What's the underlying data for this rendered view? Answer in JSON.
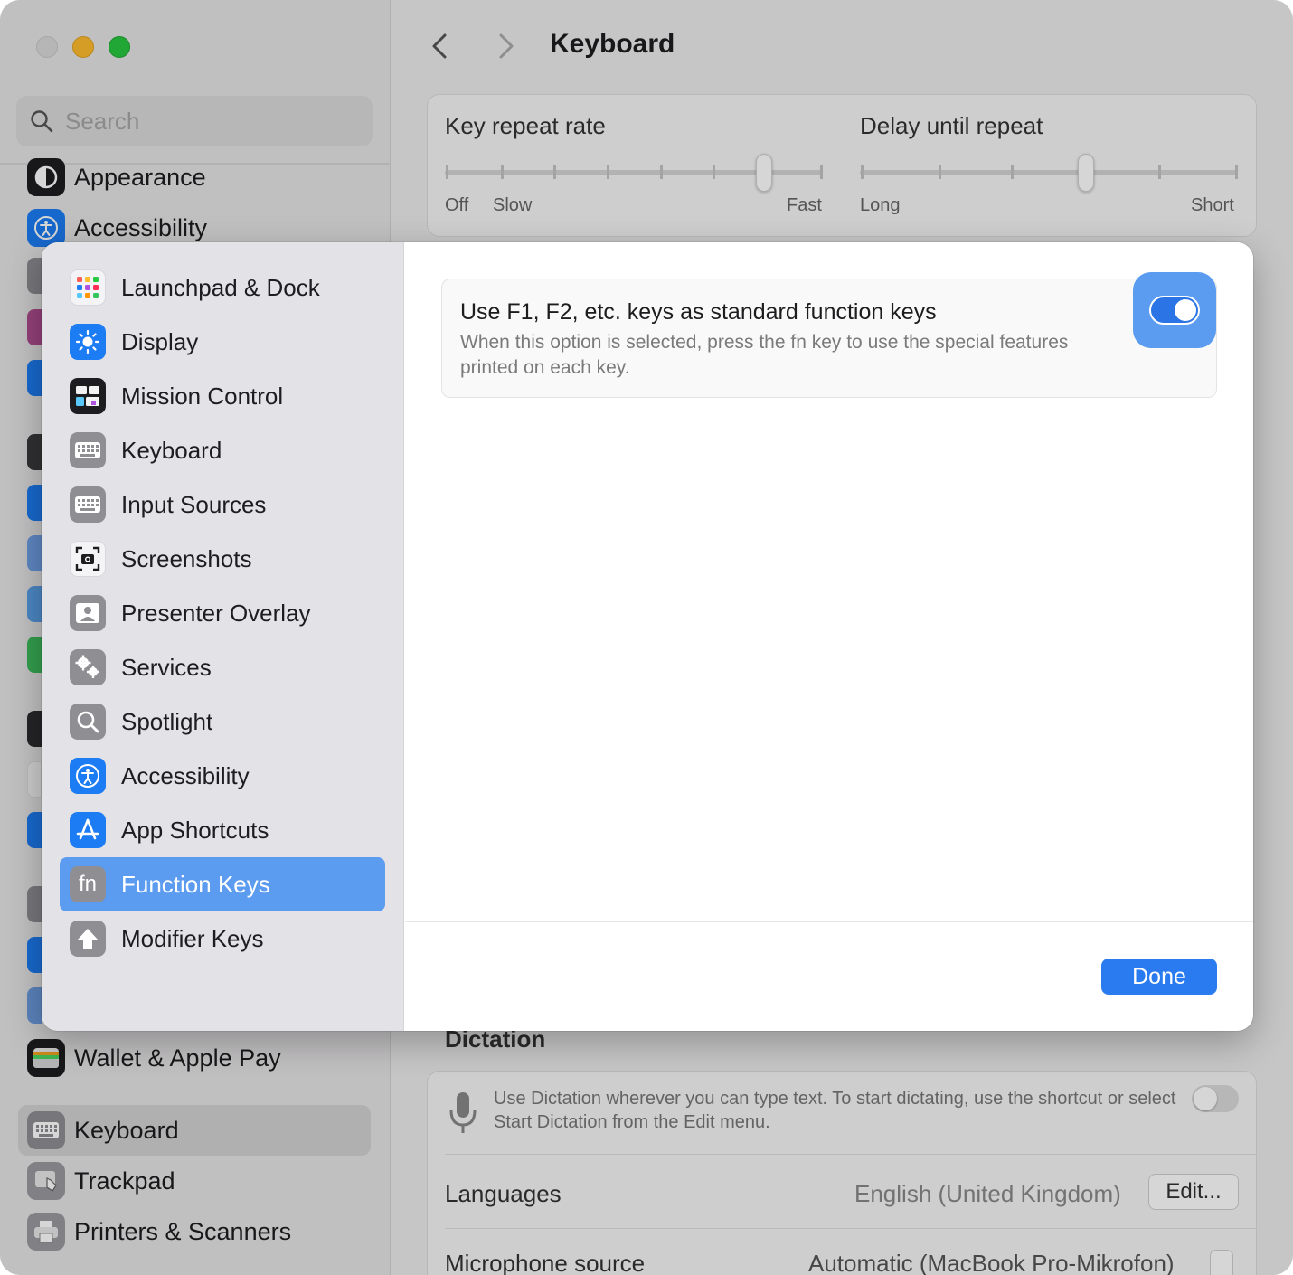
{
  "sidebar": {
    "search_placeholder": "Search",
    "items": [
      {
        "label": "Appearance"
      },
      {
        "label": "Accessibility"
      },
      {
        "label": "Wallet & Apple Pay"
      },
      {
        "label": "Keyboard"
      },
      {
        "label": "Trackpad"
      },
      {
        "label": "Printers & Scanners"
      }
    ]
  },
  "main": {
    "title": "Keyboard",
    "key_repeat": {
      "label": "Key repeat rate",
      "off": "Off",
      "slow": "Slow",
      "fast": "Fast",
      "value_step": 7,
      "steps": 8
    },
    "delay_repeat": {
      "label": "Delay until repeat",
      "long": "Long",
      "short": "Short",
      "value_step": 4,
      "steps": 6
    },
    "dictation": {
      "title": "Dictation",
      "description": "Use Dictation wherever you can type text. To start dictating, use the shortcut or select Start Dictation from the Edit menu.",
      "enabled": false,
      "languages_label": "Languages",
      "languages_value": "English (United Kingdom)",
      "edit_button": "Edit...",
      "mic_label": "Microphone source",
      "mic_value": "Automatic (MacBook Pro-Mikrofon)"
    }
  },
  "sheet": {
    "items": [
      {
        "label": "Launchpad & Dock",
        "icon": "launchpad-icon"
      },
      {
        "label": "Display",
        "icon": "display-icon"
      },
      {
        "label": "Mission Control",
        "icon": "mission-control-icon"
      },
      {
        "label": "Keyboard",
        "icon": "keyboard-icon"
      },
      {
        "label": "Input Sources",
        "icon": "input-sources-icon"
      },
      {
        "label": "Screenshots",
        "icon": "screenshots-icon"
      },
      {
        "label": "Presenter Overlay",
        "icon": "presenter-overlay-icon"
      },
      {
        "label": "Services",
        "icon": "services-icon"
      },
      {
        "label": "Spotlight",
        "icon": "spotlight-icon"
      },
      {
        "label": "Accessibility",
        "icon": "accessibility-icon"
      },
      {
        "label": "App Shortcuts",
        "icon": "app-shortcuts-icon"
      },
      {
        "label": "Function Keys",
        "icon": "fn-icon"
      },
      {
        "label": "Modifier Keys",
        "icon": "modifier-keys-icon"
      }
    ],
    "selected_index": 11,
    "fn_glyph": "fn",
    "option": {
      "title": "Use F1, F2, etc. keys as standard function keys",
      "description": "When this option is selected, press the fn key to use the special features printed on each key.",
      "enabled": true
    },
    "done_button": "Done"
  },
  "colors": {
    "accent": "#2b7bf0",
    "selection": "#5b9bf0"
  }
}
